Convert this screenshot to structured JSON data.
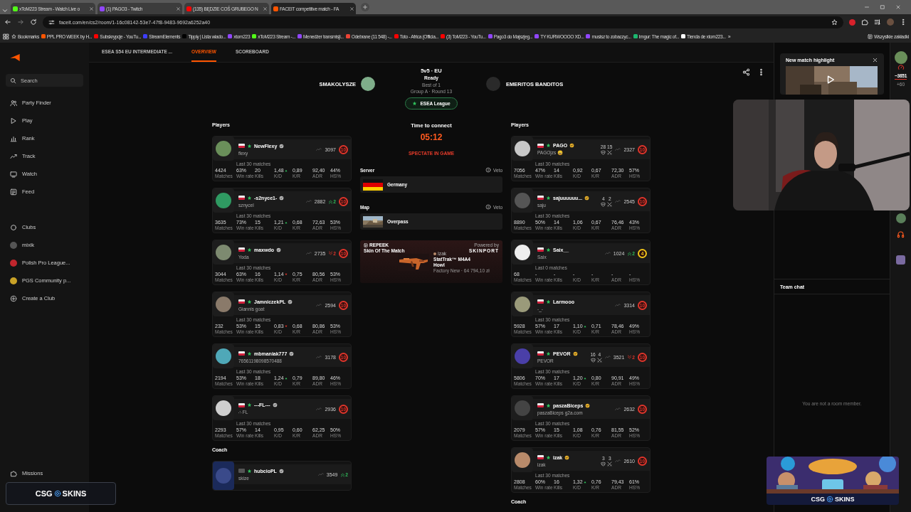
{
  "browser": {
    "tabs": [
      {
        "title": "xToM223 Stream - Watch Live o",
        "color": "#53fc18",
        "selected": false
      },
      {
        "title": "(1) PAGO3 - Twitch",
        "color": "#9146ff",
        "selected": false
      },
      {
        "title": "(135) BĘDZIE COŚ GRUBEGO N",
        "color": "#ff0000",
        "selected": false
      },
      {
        "title": "FACEIT competitive match - FA",
        "color": "#ff5500",
        "selected": true
      }
    ],
    "url": "faceit.com/en/cs2/room/1-16c08142-53e7-47f8-9483-9692a6252a40",
    "bookmarks": [
      {
        "label": "Bookmarks",
        "kind": "star"
      },
      {
        "label": "PPL PRO WEEK by H...",
        "kind": "site",
        "color": "#ff5500"
      },
      {
        "label": "Subskrypcje - YouTu...",
        "kind": "site",
        "color": "#ff0000"
      },
      {
        "label": "StreamElements",
        "kind": "site",
        "color": "#3d3dff"
      },
      {
        "label": "Tipply | Lista wiado...",
        "kind": "site",
        "color": "#000000"
      },
      {
        "label": "xtom223",
        "kind": "site",
        "color": "#9146ff"
      },
      {
        "label": "xToM223 Stream -...",
        "kind": "site",
        "color": "#53fc18"
      },
      {
        "label": "Menedżer transmisji...",
        "kind": "site",
        "color": "#9146ff"
      },
      {
        "label": "Odebrane (11 548) -...",
        "kind": "site",
        "color": "#ea4335"
      },
      {
        "label": "Toto - Africa (Officia...",
        "kind": "site",
        "color": "#ff0000"
      },
      {
        "label": "(3) ToM223 - YouTu...",
        "kind": "site",
        "color": "#ff0000"
      },
      {
        "label": "Pago3 do Majszjeg...",
        "kind": "site",
        "color": "#9146ff"
      },
      {
        "label": "TY KURWOOOO XD...",
        "kind": "site",
        "color": "#9146ff"
      },
      {
        "label": "musisz to zobaczyc...",
        "kind": "site",
        "color": "#9146ff"
      },
      {
        "label": "Imgur: The magic of...",
        "kind": "site",
        "color": "#1bb76e"
      },
      {
        "label": "Tienda de xtom223...",
        "kind": "site",
        "color": "#ffffff"
      }
    ],
    "more": "»",
    "all_bookmarks": "Wszystkie zakładki"
  },
  "sidebar": {
    "search": "Search",
    "nav": [
      {
        "label": "Party Finder"
      },
      {
        "label": "Play"
      },
      {
        "label": "Rank"
      },
      {
        "label": "Track"
      },
      {
        "label": "Watch"
      },
      {
        "label": "Feed"
      }
    ],
    "clubs": [
      {
        "label": "Clubs",
        "kind": "header"
      },
      {
        "label": "mixik",
        "kind": "club"
      },
      {
        "label": "Polish Pro League...",
        "kind": "club"
      },
      {
        "label": "PGS Community p...",
        "kind": "club"
      },
      {
        "label": "Create a Club",
        "kind": "create"
      }
    ],
    "missions": "Missions"
  },
  "room_tabs": [
    {
      "label": "ESEA S54 EU INTERMEDIATE ...",
      "selected": false
    },
    {
      "label": "OVERVIEW",
      "selected": true
    },
    {
      "label": "SCOREBOARD",
      "selected": false
    }
  ],
  "header": {
    "team_1": "SMAKOLYSZE",
    "mode": "5v5 · EU",
    "status": "Ready",
    "format": "Best of 1",
    "stage": "Group A · Round 13",
    "league": "ESEA League",
    "team_2": "EMERITOS BANDITOS"
  },
  "connect": {
    "title": "Time to connect",
    "countdown": "05:12",
    "action": "SPECTATE IN GAME",
    "server_heading": "Server",
    "server_veto": "Veto",
    "server": "Germany",
    "map_heading": "Map",
    "map_veto": "Veto",
    "map": "Overpass"
  },
  "skin_card": {
    "brand": "REPEEK",
    "title": "Skin Of The Match",
    "powered_by": "Powered by",
    "sponsor": "SKINPORT",
    "owner": "Izak",
    "weapon": "StatTrak™ M4A4",
    "skin": "Howl",
    "price": "Factory New · 64 794,10 zł"
  },
  "teams": [
    {
      "heading": "Players",
      "players": [
        {
          "name": "NewFlexy",
          "nickname": "flexy",
          "verified": true,
          "gold": false,
          "elo": "3097",
          "level": "10",
          "color": "#e0352b",
          "kd_rising": true,
          "matches_label": "Last 30 matches",
          "stats": [
            {
              "value": "4424",
              "label": "Matches"
            },
            {
              "value": "63%",
              "label": "Win rate"
            },
            {
              "value": "20",
              "label": "Kills"
            },
            {
              "value": "1,48",
              "label": "K/D"
            },
            {
              "value": "0,89",
              "label": "K/R"
            },
            {
              "value": "92,40",
              "label": "ADR"
            },
            {
              "value": "44%",
              "label": "HS%"
            }
          ]
        },
        {
          "name": "-s2nyce1-",
          "nickname": "sznycel",
          "verified": true,
          "gold": false,
          "elo": "2882",
          "streak": {
            "up": true,
            "count": "2"
          },
          "level": "10",
          "color": "#e0352b",
          "kd_rising": true,
          "matches_label": "Last 30 matches",
          "stats": [
            {
              "value": "3635",
              "label": "Matches"
            },
            {
              "value": "73%",
              "label": "Win rate"
            },
            {
              "value": "15",
              "label": "Kills"
            },
            {
              "value": "1,21",
              "label": "K/D"
            },
            {
              "value": "0,68",
              "label": "K/R"
            },
            {
              "value": "72,63",
              "label": "ADR"
            },
            {
              "value": "53%",
              "label": "HS%"
            }
          ]
        },
        {
          "name": "maxwdo",
          "nickname": "Yoda",
          "verified": true,
          "gold": false,
          "elo": "2735",
          "streak": {
            "up": false,
            "count": "2"
          },
          "level": "10",
          "color": "#e0352b",
          "kd_rising": false,
          "matches_label": "Last 30 matches",
          "stats": [
            {
              "value": "3044",
              "label": "Matches"
            },
            {
              "value": "63%",
              "label": "Win rate"
            },
            {
              "value": "16",
              "label": "Kills"
            },
            {
              "value": "1,14",
              "label": "K/D"
            },
            {
              "value": "0,75",
              "label": "K/R"
            },
            {
              "value": "80,56",
              "label": "ADR"
            },
            {
              "value": "53%",
              "label": "HS%"
            }
          ]
        },
        {
          "name": "JamniczekPL",
          "nickname": "Giannis goat",
          "verified": true,
          "gold": false,
          "elo": "2594",
          "level": "10",
          "color": "#e0352b",
          "kd_rising": false,
          "matches_label": "Last 30 matches",
          "stats": [
            {
              "value": "232",
              "label": "Matches"
            },
            {
              "value": "53%",
              "label": "Win rate"
            },
            {
              "value": "15",
              "label": "Kills"
            },
            {
              "value": "0,83",
              "label": "K/D"
            },
            {
              "value": "0,68",
              "label": "K/R"
            },
            {
              "value": "80,86",
              "label": "ADR"
            },
            {
              "value": "53%",
              "label": "HS%"
            }
          ]
        },
        {
          "name": "mbmaniak777",
          "nickname": "76561198098570488",
          "verified": true,
          "gold": false,
          "elo": "3178",
          "level": "10",
          "color": "#e0352b",
          "kd_rising": true,
          "matches_label": "Last 30 matches",
          "stats": [
            {
              "value": "2194",
              "label": "Matches"
            },
            {
              "value": "53%",
              "label": "Win rate"
            },
            {
              "value": "18",
              "label": "Kills"
            },
            {
              "value": "1,24",
              "label": "K/D"
            },
            {
              "value": "0,79",
              "label": "K/R"
            },
            {
              "value": "89,80",
              "label": "ADR"
            },
            {
              "value": "46%",
              "label": "HS%"
            }
          ]
        },
        {
          "name": "---FL---",
          "nickname": "∴ FL",
          "verified": true,
          "gold": false,
          "elo": "2936",
          "level": "10",
          "color": "#e0352b",
          "matches_label": "Last 30 matches",
          "stats": [
            {
              "value": "2293",
              "label": "Matches"
            },
            {
              "value": "57%",
              "label": "Win rate"
            },
            {
              "value": "14",
              "label": "Kills"
            },
            {
              "value": "0,95",
              "label": "K/D"
            },
            {
              "value": "0,60",
              "label": "K/R"
            },
            {
              "value": "62,25",
              "label": "ADR"
            },
            {
              "value": "50%",
              "label": "HS%"
            }
          ]
        }
      ],
      "coach_heading": "Coach",
      "coach": {
        "name": "hubcioPL",
        "nickname": "skize",
        "flag_unknown": true,
        "verified": true,
        "gold": false,
        "elo": "3549",
        "streak": {
          "up": true,
          "count": "2"
        }
      }
    },
    {
      "heading": "Players",
      "players": [
        {
          "name": "PAGO",
          "nickname": "PAGOjzs 😄",
          "verified": true,
          "gold": true,
          "party": [
            "28",
            "15"
          ],
          "elo": "2327",
          "level": "10",
          "color": "#e0352b",
          "matches_label": "Last 30 matches",
          "stats": [
            {
              "value": "7056",
              "label": "Matches"
            },
            {
              "value": "47%",
              "label": "Win rate"
            },
            {
              "value": "14",
              "label": "Kills"
            },
            {
              "value": "0,92",
              "label": "K/D"
            },
            {
              "value": "0,67",
              "label": "K/R"
            },
            {
              "value": "72,30",
              "label": "ADR"
            },
            {
              "value": "57%",
              "label": "HS%"
            }
          ]
        },
        {
          "name": "sajuuuuuu...",
          "nickname": "saju",
          "verified": true,
          "gold": true,
          "party": [
            "4",
            "2"
          ],
          "elo": "2545",
          "level": "10",
          "color": "#e0352b",
          "matches_label": "Last 30 matches",
          "stats": [
            {
              "value": "8890",
              "label": "Matches"
            },
            {
              "value": "50%",
              "label": "Win rate"
            },
            {
              "value": "14",
              "label": "Kills"
            },
            {
              "value": "1,06",
              "label": "K/D"
            },
            {
              "value": "0,67",
              "label": "K/R"
            },
            {
              "value": "76,46",
              "label": "ADR"
            },
            {
              "value": "43%",
              "label": "HS%"
            }
          ]
        },
        {
          "name": "Saix__",
          "nickname": "Saix",
          "verified": false,
          "elo": "1024",
          "streak": {
            "up": true,
            "count": "2"
          },
          "level": "4",
          "color": "#f0c419",
          "matches_label": "Last 0 matches",
          "stats": [
            {
              "value": "68",
              "label": "Matches"
            },
            {
              "value": "-",
              "label": "Win rate"
            },
            {
              "value": "-",
              "label": "Kills"
            },
            {
              "value": "-",
              "label": "K/D"
            },
            {
              "value": "-",
              "label": "K/R"
            },
            {
              "value": "-",
              "label": "ADR"
            },
            {
              "value": "-",
              "label": "HS%"
            }
          ]
        },
        {
          "name": "Larmooo",
          "nickname": "-_-",
          "verified": false,
          "elo": "3314",
          "level": "10",
          "color": "#e0352b",
          "kd_rising": true,
          "matches_label": "Last 30 matches",
          "stats": [
            {
              "value": "5928",
              "label": "Matches"
            },
            {
              "value": "57%",
              "label": "Win rate"
            },
            {
              "value": "17",
              "label": "Kills"
            },
            {
              "value": "1,10",
              "label": "K/D"
            },
            {
              "value": "0,71",
              "label": "K/R"
            },
            {
              "value": "78,46",
              "label": "ADR"
            },
            {
              "value": "49%",
              "label": "HS%"
            }
          ]
        },
        {
          "name": "PEVOR",
          "nickname": "PEVOR",
          "verified": true,
          "gold": true,
          "party": [
            "16",
            "4"
          ],
          "elo": "3521",
          "streak": {
            "up": false,
            "count": "2"
          },
          "level": "10",
          "color": "#e0352b",
          "kd_rising": true,
          "matches_label": "Last 30 matches",
          "stats": [
            {
              "value": "5806",
              "label": "Matches"
            },
            {
              "value": "70%",
              "label": "Win rate"
            },
            {
              "value": "17",
              "label": "Kills"
            },
            {
              "value": "1,20",
              "label": "K/D"
            },
            {
              "value": "0,80",
              "label": "K/R"
            },
            {
              "value": "90,91",
              "label": "ADR"
            },
            {
              "value": "49%",
              "label": "HS%"
            }
          ]
        },
        {
          "name": "paszaBiceps",
          "nickname": "paszaBiceps g2a.com",
          "verified": true,
          "gold": true,
          "elo": "2632",
          "level": "10",
          "color": "#e0352b",
          "matches_label": "Last 30 matches",
          "stats": [
            {
              "value": "2079",
              "label": "Matches"
            },
            {
              "value": "57%",
              "label": "Win rate"
            },
            {
              "value": "15",
              "label": "Kills"
            },
            {
              "value": "1,08",
              "label": "K/D"
            },
            {
              "value": "0,76",
              "label": "K/R"
            },
            {
              "value": "81,55",
              "label": "ADR"
            },
            {
              "value": "52%",
              "label": "HS%"
            }
          ]
        },
        {
          "name": "izak",
          "nickname": "izak",
          "verified": true,
          "gold": true,
          "party": [
            "3",
            "3"
          ],
          "elo": "2610",
          "level": "10",
          "color": "#e0352b",
          "kd_rising": true,
          "matches_label": "Last 30 matches",
          "stats": [
            {
              "value": "2808",
              "label": "Matches"
            },
            {
              "value": "60%",
              "label": "Win rate"
            },
            {
              "value": "16",
              "label": "Kills"
            },
            {
              "value": "1,32",
              "label": "K/D"
            },
            {
              "value": "0,76",
              "label": "K/R"
            },
            {
              "value": "79,43",
              "label": "ADR"
            },
            {
              "value": "61%",
              "label": "HS%"
            }
          ]
        }
      ],
      "coach_heading": "Coach"
    }
  ],
  "highlight": {
    "title": "New match highlight"
  },
  "chat": {
    "title": "Team chat",
    "notice": "You are not a room member."
  },
  "rail": {
    "elo": "~3651",
    "change": "+60"
  },
  "overlays": {
    "logo_box": {
      "brand_left": "CSG",
      "brand_right": "SKINS"
    },
    "banner": {
      "brand_left": "CSG",
      "brand_right": "SKINS"
    }
  }
}
